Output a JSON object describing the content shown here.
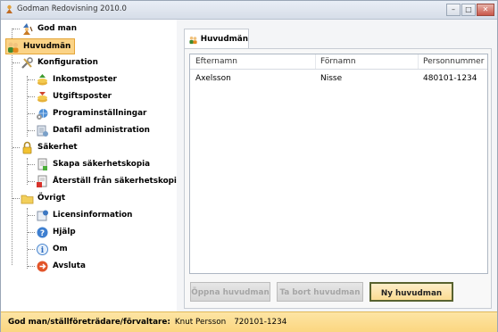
{
  "window": {
    "title": "Godman Redovisning 2010.0"
  },
  "sidebar": {
    "items": [
      {
        "label": "God man",
        "icon": "wizard-icon"
      },
      {
        "label": "Huvudmän",
        "icon": "users-icon",
        "selected": true
      },
      {
        "label": "Konfiguration",
        "icon": "tools-icon"
      },
      {
        "label": "Inkomstposter",
        "icon": "coins-in-icon"
      },
      {
        "label": "Utgiftsposter",
        "icon": "coins-out-icon"
      },
      {
        "label": "Programinställningar",
        "icon": "settings-globe-icon"
      },
      {
        "label": "Datafil administration",
        "icon": "database-icon"
      },
      {
        "label": "Säkerhet",
        "icon": "padlock-icon"
      },
      {
        "label": "Skapa säkerhetskopia",
        "icon": "backup-icon"
      },
      {
        "label": "Återställ från säkerhetskopia",
        "icon": "restore-icon"
      },
      {
        "label": "Övrigt",
        "icon": "folder-icon"
      },
      {
        "label": "Licensinformation",
        "icon": "license-icon"
      },
      {
        "label": "Hjälp",
        "icon": "help-icon"
      },
      {
        "label": "Om",
        "icon": "info-icon"
      },
      {
        "label": "Avsluta",
        "icon": "exit-icon"
      }
    ]
  },
  "tab": {
    "label": "Huvudmän"
  },
  "table": {
    "columns": [
      "Efternamn",
      "Förnamn",
      "Personnummer"
    ],
    "rows": [
      [
        "Axelsson",
        "Nisse",
        "480101-1234"
      ]
    ]
  },
  "buttons": {
    "open": "Öppna huvudman",
    "remove": "Ta bort huvudman",
    "new": "Ny huvudman"
  },
  "status": {
    "label": "God man/ställföreträdare/förvaltare:",
    "name": "Knut Persson",
    "personnummer": "720101-1234"
  },
  "colors": {
    "selection": "#fbd386",
    "statusbar": "#fbd680",
    "active_button": "#fbdc92"
  }
}
